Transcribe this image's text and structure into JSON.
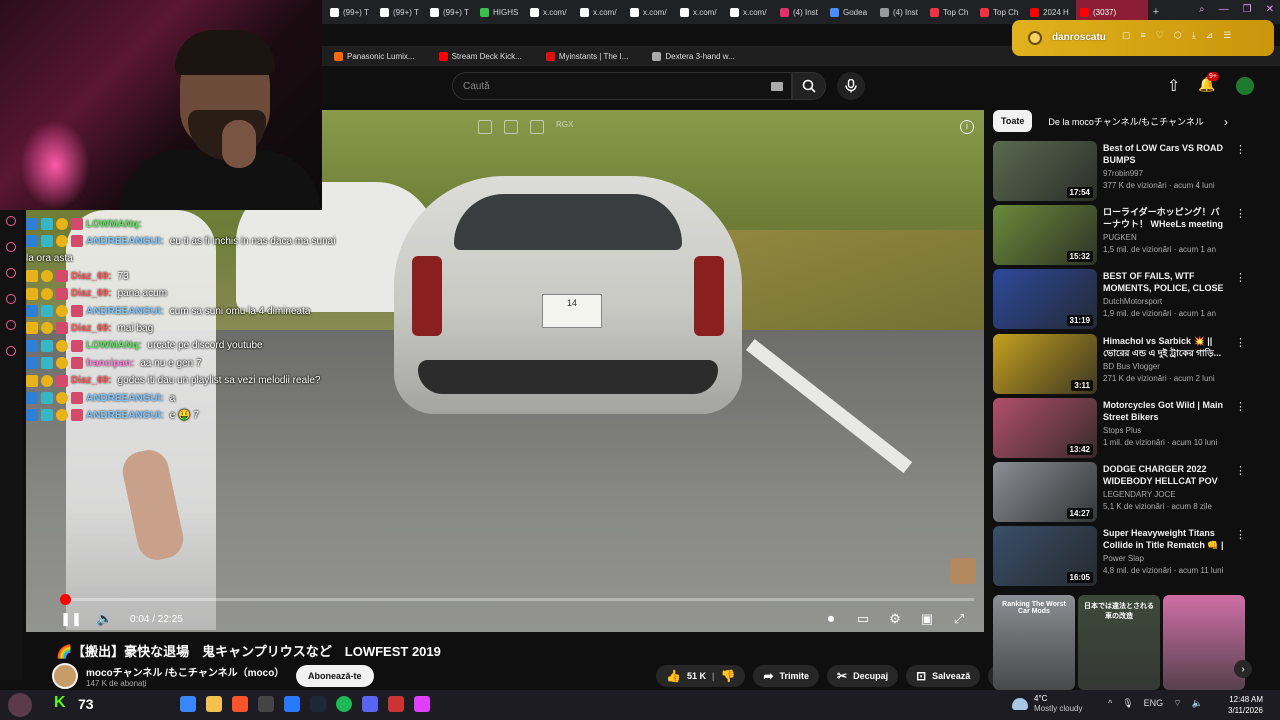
{
  "browser": {
    "tabs": [
      {
        "label": "(99+) T",
        "icon_color": "#ffffff"
      },
      {
        "label": "(99+) T",
        "icon_color": "#ffffff"
      },
      {
        "label": "(99+) T",
        "icon_color": "#ffffff"
      },
      {
        "label": "HIGHS",
        "icon_color": "#37c04a"
      },
      {
        "label": "x.com/",
        "icon_color": "#ffffff"
      },
      {
        "label": "x.com/",
        "icon_color": "#ffffff"
      },
      {
        "label": "x.com/",
        "icon_color": "#ffffff"
      },
      {
        "label": "x.com/",
        "icon_color": "#ffffff"
      },
      {
        "label": "x.com/",
        "icon_color": "#ffffff"
      },
      {
        "label": "(4) Inst",
        "icon_color": "#e1306c"
      },
      {
        "label": "Godea",
        "icon_color": "#4a8df8"
      },
      {
        "label": "(4) Inst",
        "icon_color": "#999999"
      },
      {
        "label": "Top Ch",
        "icon_color": "#e34"
      },
      {
        "label": "Top Ch",
        "icon_color": "#e34"
      },
      {
        "label": "2024 H",
        "icon_color": "#ff0000"
      }
    ],
    "active_tab": {
      "label": "(3037)",
      "icon_color": "#ff0000"
    },
    "new_tab": "+",
    "bookmarks": [
      {
        "label": "Panasonic Lumix...",
        "icon_color": "#ff6a00"
      },
      {
        "label": "Stream Deck Kick...",
        "icon_color": "#ff0000"
      },
      {
        "label": "Myinstants | The I...",
        "icon_color": "#d11"
      },
      {
        "label": "Dextera 3-hand w...",
        "icon_color": "#aaaaaa"
      }
    ]
  },
  "youtube": {
    "search_placeholder": "Caută",
    "notif_count": "9+",
    "chips": [
      "Toate",
      "De la mocoチャンネル/もこチャンネル（m"
    ],
    "video": {
      "title": "🌈【搬出】豪快な退場　鬼キャンプリウスなど　LOWFEST 2019",
      "time": "0:04 / 22:25",
      "progress": 0.003,
      "plate": "14",
      "overlay_label": "RGX"
    },
    "channel": {
      "name": "mocoチャンネル /もこチャンネル（moco）",
      "subs": "147 K de abonați",
      "subscribe_label": "Abonează-te"
    },
    "actions": {
      "like_count": "51 K",
      "share": "Trimite",
      "clip": "Decupaj",
      "save": "Salvează"
    },
    "recommendations": [
      {
        "title": "Best of LOW Cars VS ROAD BUMPS",
        "channel": "97robin997",
        "meta": "377 K de vizionări · acum 4 luni",
        "duration": "17:54",
        "color": "#5a6a50"
      },
      {
        "title": "ローライダーホッピング！バーナウト！ WHeeLs meeting ...",
        "channel": "PUGKEN",
        "meta": "1,5 mil. de vizionări · acum 1 an",
        "duration": "15:32",
        "color": "#6b8a3a"
      },
      {
        "title": "BEST OF FAILS, WTF MOMENTS, POLICE, CLOSE ...",
        "channel": "DutchMotorsport",
        "meta": "1,9 mil. de vizionări · acum 1 an",
        "duration": "31:19",
        "color": "#2d4a9a"
      },
      {
        "title": "Himachol vs Sarbick 💥 || ভোরের এন্ড এ দুই ট্রাকের গাড়ি...",
        "channel": "BD Bus Vlogger",
        "meta": "271 K de vizionări · acum 2 luni",
        "duration": "3:11",
        "color": "#c4a020"
      },
      {
        "title": "Motorcycles Got Wild | Main Street Bikers",
        "channel": "Stops Plus",
        "meta": "1 mil. de vizionări · acum 10 luni",
        "duration": "13:42",
        "color": "#b0506a"
      },
      {
        "title": "DODGE CHARGER 2022 WIDEBODY HELLCAT POV ...",
        "channel": "LEGENDARY JOCE",
        "meta": "5,1 K de vizionări · acum 8 zile",
        "duration": "14:27",
        "color": "#8a8f96"
      },
      {
        "title": "Super Heavyweight Titans Collide in Title Rematch 👊 | D...",
        "channel": "Power Slap",
        "meta": "4,8 mil. de vizionări · acum 11 luni",
        "duration": "16:05",
        "color": "#3a4f6a"
      }
    ],
    "shorts": [
      {
        "caption": "Ranking The Worst Car Mods",
        "color": "#8a8f93"
      },
      {
        "caption": "日本では違法とされる車の改造",
        "color": "#3d4a3a"
      },
      {
        "caption": "",
        "color": "#cf6fa6"
      }
    ]
  },
  "notification": {
    "name": "danroscatu"
  },
  "chat": [
    {
      "user": "LOWMANq:",
      "msg": "",
      "color": "#5ae05a"
    },
    {
      "user": "ANDREEANGUI:",
      "msg": "eu ti as fi inchis in nas daca ma sunai",
      "color": "#7ac4ff"
    },
    {
      "user": "",
      "msg": "la ora asta",
      "color": "#ffffff"
    },
    {
      "user": "Diaz_69:",
      "msg": "73",
      "color": "#ff5a5a"
    },
    {
      "user": "Diaz_69:",
      "msg": "pana acum",
      "color": "#ff5a5a"
    },
    {
      "user": "ANDREEANGUI:",
      "msg": "cum sa suni omu la 4 dimineata",
      "color": "#7ac4ff"
    },
    {
      "user": "Diaz_69:",
      "msg": "mai bag",
      "color": "#ff5a5a"
    },
    {
      "user": "LOWMANq:",
      "msg": "urcate pe discord youtube",
      "color": "#5ae05a"
    },
    {
      "user": "francipan:",
      "msg": "aa nu e gen 7",
      "color": "#ff7ad9"
    },
    {
      "user": "Diaz_69:",
      "msg": "godes iti dau un playlist sa vezi melodii reale?",
      "color": "#ff5a5a"
    },
    {
      "user": "ANDREEANGUI:",
      "msg": "a",
      "color": "#7ac4ff"
    },
    {
      "user": "ANDREEANGUI:",
      "msg": "e 🤑 7",
      "color": "#7ac4ff"
    }
  ],
  "taskbar": {
    "viewer_count": "73",
    "weather_temp": "4°C",
    "weather_desc": "Mostly cloudy",
    "lang": "ENG",
    "time": "12:48 AM",
    "date": "3/11/2026"
  }
}
